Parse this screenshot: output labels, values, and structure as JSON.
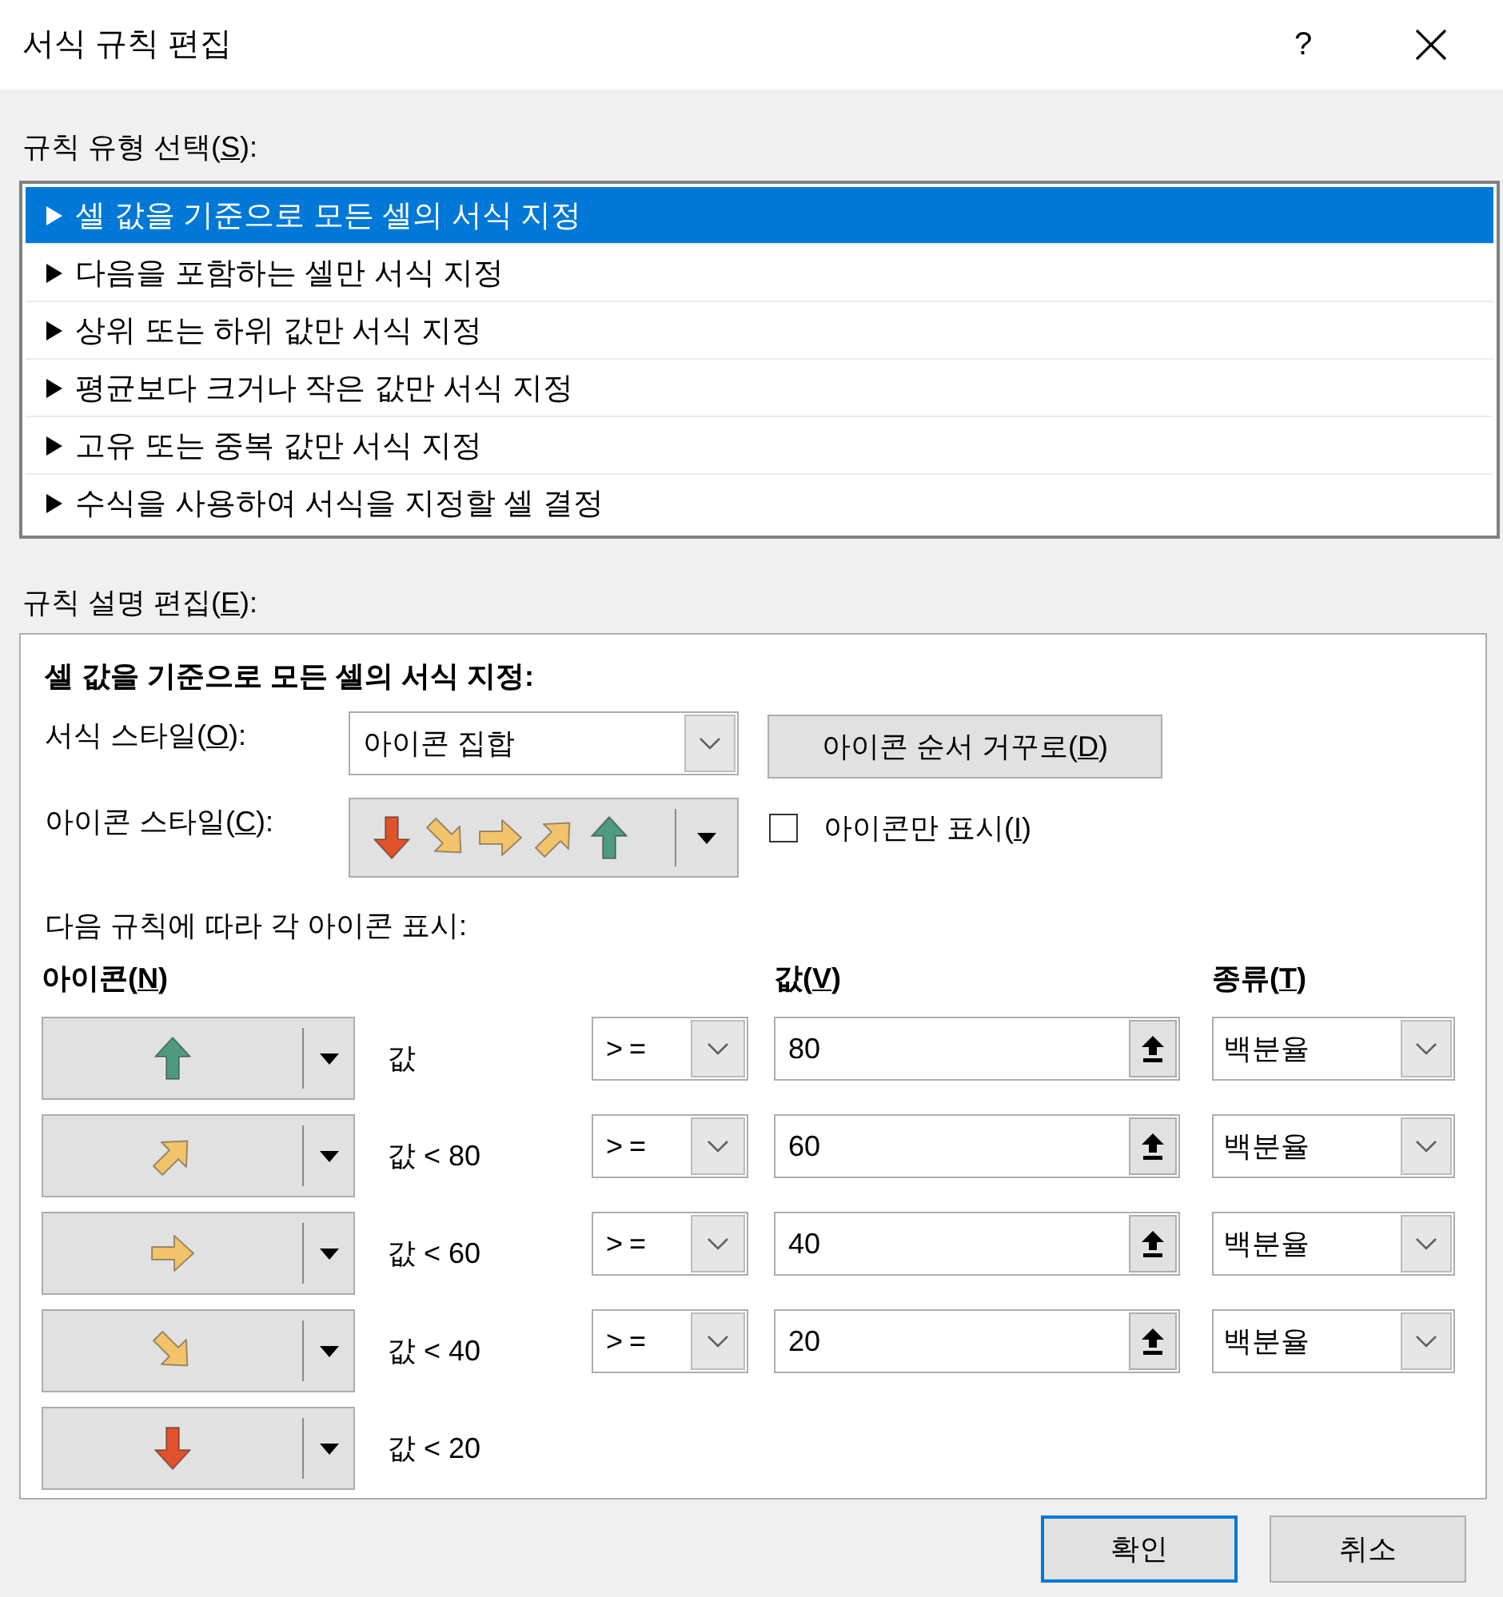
{
  "window": {
    "title": "서식 규칙 편집",
    "help_button": "?"
  },
  "rule_type": {
    "label": {
      "before": "규칙 유형 선택(",
      "mnemonic": "S",
      "after": "):"
    },
    "items": [
      {
        "text": "셀 값을 기준으로 모든 셀의 서식 지정",
        "selected": true
      },
      {
        "text": "다음을 포함하는 셀만 서식 지정",
        "selected": false
      },
      {
        "text": "상위 또는 하위 값만 서식 지정",
        "selected": false
      },
      {
        "text": "평균보다 크거나 작은 값만 서식 지정",
        "selected": false
      },
      {
        "text": "고유 또는 중복 값만 서식 지정",
        "selected": false
      },
      {
        "text": "수식을 사용하여 서식을 지정할 셀 결정",
        "selected": false
      }
    ]
  },
  "rule_description": {
    "label": {
      "before": "규칙 설명 편집(",
      "mnemonic": "E",
      "after": "):"
    },
    "heading": "셀 값을 기준으로 모든 셀의 서식 지정:",
    "format_style": {
      "label": {
        "before": "서식 스타일(",
        "mnemonic": "O",
        "after": "):"
      },
      "value": "아이콘 집합"
    },
    "reverse_button": {
      "before": "아이콘 순서 거꾸로(",
      "mnemonic": "D",
      "after": ")"
    },
    "icon_style": {
      "label": {
        "before": "아이콘 스타일(",
        "mnemonic": "C",
        "after": "):"
      },
      "icons": [
        {
          "kind": "down",
          "color": "#e0522c"
        },
        {
          "kind": "downright",
          "color": "#f2c36b"
        },
        {
          "kind": "right",
          "color": "#f2c36b"
        },
        {
          "kind": "upright",
          "color": "#f2c36b"
        },
        {
          "kind": "up",
          "color": "#4f9a7e"
        }
      ]
    },
    "show_icon_only": {
      "label": {
        "before": "아이콘만 표시(",
        "mnemonic": "I",
        "after": ")"
      },
      "checked": false
    },
    "rules_caption": "다음 규칙에 따라 각 아이콘 표시:",
    "column_headers": {
      "icon": {
        "before": "아이콘(",
        "mnemonic": "N",
        "after": ")"
      },
      "value": {
        "before": "값(",
        "mnemonic": "V",
        "after": ")"
      },
      "type": {
        "before": "종류(",
        "mnemonic": "T",
        "after": ")"
      }
    },
    "rules": [
      {
        "kind": "up",
        "color": "#4f9a7e",
        "condition": "값",
        "operator": ">=",
        "value": "80",
        "type": "백분율"
      },
      {
        "kind": "upright",
        "color": "#f2c36b",
        "condition": "값 < 80",
        "operator": ">=",
        "value": "60",
        "type": "백분율"
      },
      {
        "kind": "right",
        "color": "#f2c36b",
        "condition": "값 < 60",
        "operator": ">=",
        "value": "40",
        "type": "백분율"
      },
      {
        "kind": "downright",
        "color": "#f2c36b",
        "condition": "값 < 40",
        "operator": ">=",
        "value": "20",
        "type": "백분율"
      },
      {
        "kind": "down",
        "color": "#e0522c",
        "condition": "값 < 20"
      }
    ]
  },
  "buttons": [
    {
      "label": "확인",
      "default": true
    },
    {
      "label": "취소",
      "default": false
    }
  ]
}
